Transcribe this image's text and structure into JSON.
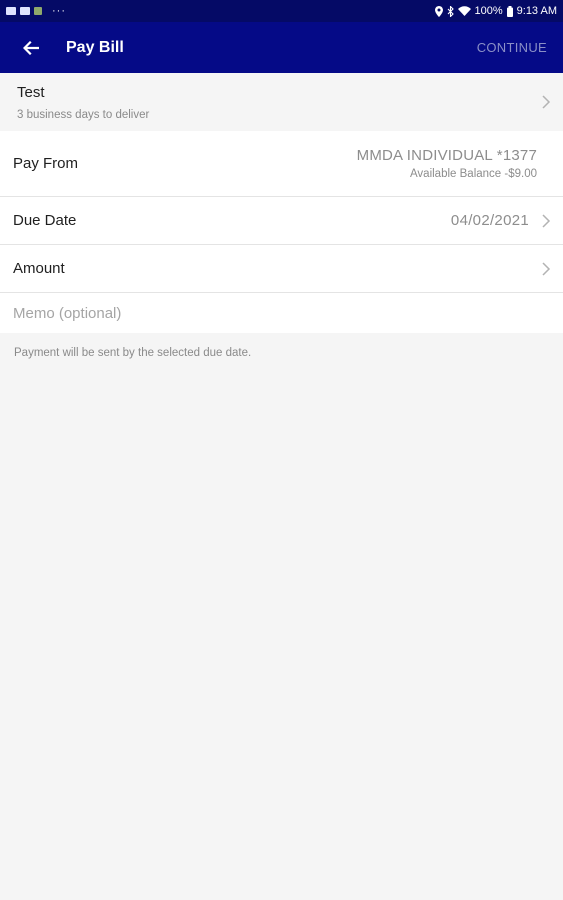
{
  "status_bar": {
    "battery": "100%",
    "time": "9:13 AM",
    "more_indicator": "···"
  },
  "header": {
    "title": "Pay Bill",
    "continue_label": "CONTINUE",
    "colors": {
      "status_bar": "#050a66",
      "app_bar": "#050a87",
      "continue_disabled": "#8a8fc6"
    }
  },
  "payee": {
    "name": "Test",
    "delivery": "3 business days to deliver"
  },
  "pay_from": {
    "label": "Pay From",
    "account": "MMDA INDIVIDUAL *1377",
    "balance": "Available Balance -$9.00"
  },
  "due_date": {
    "label": "Due Date",
    "value": "04/02/2021"
  },
  "amount": {
    "label": "Amount"
  },
  "memo": {
    "placeholder": "Memo (optional)",
    "value": ""
  },
  "note": "Payment will be sent by the selected due date."
}
